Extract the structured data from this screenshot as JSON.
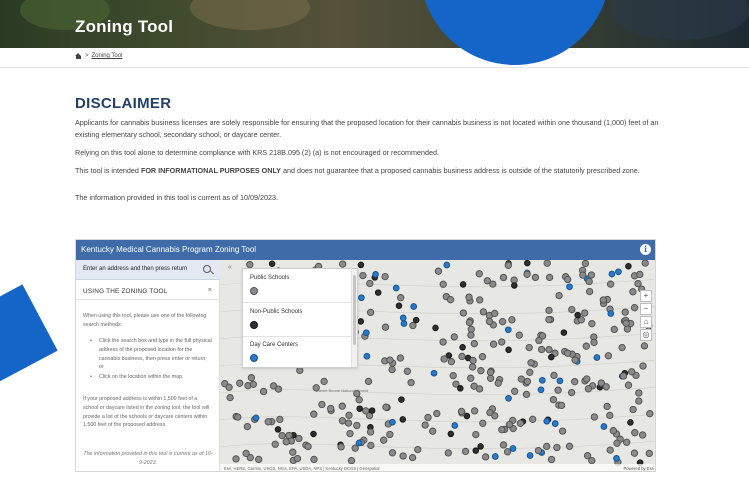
{
  "hero": {
    "title": "Zoning Tool"
  },
  "breadcrumb": {
    "current": "Zoning Tool"
  },
  "disclaimer": {
    "title": "DISCLAIMER",
    "p1": "Applicants for cannabis business licenses are solely responsible for ensuring that the proposed location for their cannabis business is not located within one thousand (1,000) feet of an existing elementary school, secondary school, or daycare center.",
    "p2": "Relying on this tool alone to determine compliance with KRS 218B.095 (2) (a) is not encouraged or recommended.",
    "p3_pre": "This tool is intended ",
    "p3_bold": "FOR INFORMATIONAL PURPOSES ONLY",
    "p3_post": " and does not guarantee that a proposed cannabis business address is outside of the statutorily prescribed zone.",
    "p4": "The information provided in this tool is current as of 10/09/2023."
  },
  "widget": {
    "title": "Kentucky Medical Cannabis Program Zoning Tool",
    "info_icon": "i",
    "search_placeholder": "Enter an address and then press return",
    "panel_title": "USING THE ZONING TOOL",
    "close_symbol": "×",
    "collapse_symbol": "«",
    "instructions_intro": "When using this tool, please use one of the following search methods:",
    "bullets": [
      "Click the search box and type in the full physical address of the proposed location for the cannabis business, then press enter or return; or",
      "Click on the location within the map."
    ],
    "instructions_result": "If your proposed address is within 1,500 feet of a school or daycare listed in the zoning tool, the tool will provide a list of the schools or daycare centers within 1,500 feet of the proposed address.",
    "instructions_date": "The information provided in this tool is current as of 10-9-2023."
  },
  "legend": {
    "items": [
      {
        "label": "Public Schools",
        "color": "#8a8a8a"
      },
      {
        "label": "Non-Public Schools",
        "color": "#2f2f2f"
      },
      {
        "label": "Day Care Centers",
        "color": "#2a78c8"
      }
    ]
  },
  "map": {
    "zoom_in": "+",
    "zoom_out": "−",
    "attribution": "Esri, HERE, Garmin, USGS, NGA, EPA, USDA, NPS | Kentucky DCGS | Geospatial",
    "attribution_right": "Powered by Esri",
    "label": "Daniel Boone National Forest",
    "colors": {
      "public": "#8a8a8a",
      "non_public": "#2f2f2f",
      "daycare": "#2a78c8",
      "header": "#3f6ca8",
      "brand_blue": "#1565c8",
      "title_navy": "#23406b"
    }
  }
}
